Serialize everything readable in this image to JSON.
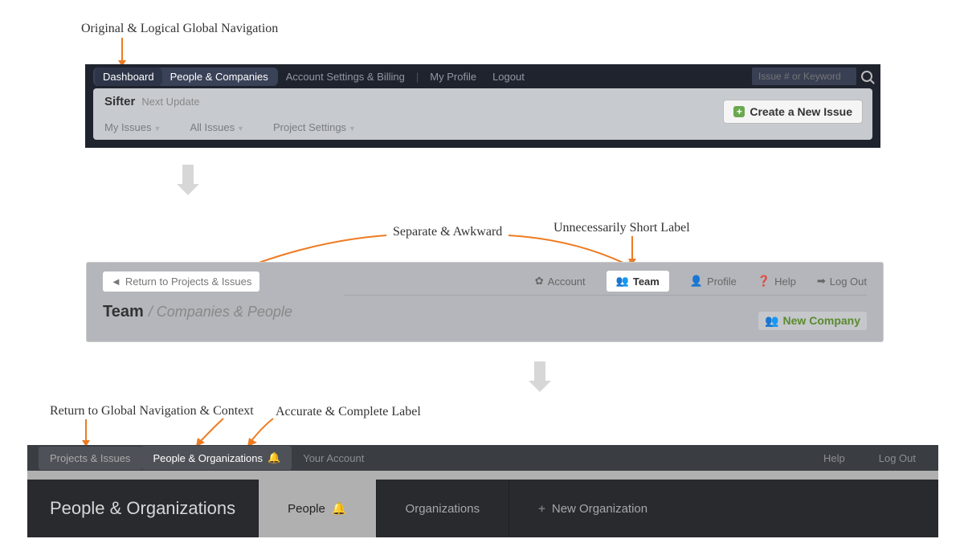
{
  "annotations": {
    "a1": "Original & Logical Global Navigation",
    "a2": "Separate & Awkward",
    "a3": "Unnecessarily Short Label",
    "a4": "Return to Global Navigation & Context",
    "a5": "Accurate & Complete Label"
  },
  "stage1": {
    "dashboard": "Dashboard",
    "people_companies": "People & Companies",
    "account_settings": "Account Settings & Billing",
    "my_profile": "My Profile",
    "logout": "Logout",
    "search_placeholder": "Issue # or Keyword",
    "brand": "Sifter",
    "subtitle": "Next Update",
    "my_issues": "My Issues",
    "all_issues": "All Issues",
    "project_settings": "Project Settings",
    "create_issue": "Create a New Issue"
  },
  "stage2": {
    "return": "Return to Projects & Issues",
    "account": "Account",
    "team": "Team",
    "profile": "Profile",
    "help": "Help",
    "logout": "Log Out",
    "title": "Team",
    "breadcrumb": "/ Companies & People",
    "new_company": "New Company"
  },
  "stage3": {
    "projects_issues": "Projects & Issues",
    "people_orgs": "People & Organizations",
    "your_account": "Your Account",
    "help": "Help",
    "logout": "Log Out",
    "title": "People & Organizations",
    "tab_people": "People",
    "tab_orgs": "Organizations",
    "tab_new": "New Organization"
  }
}
